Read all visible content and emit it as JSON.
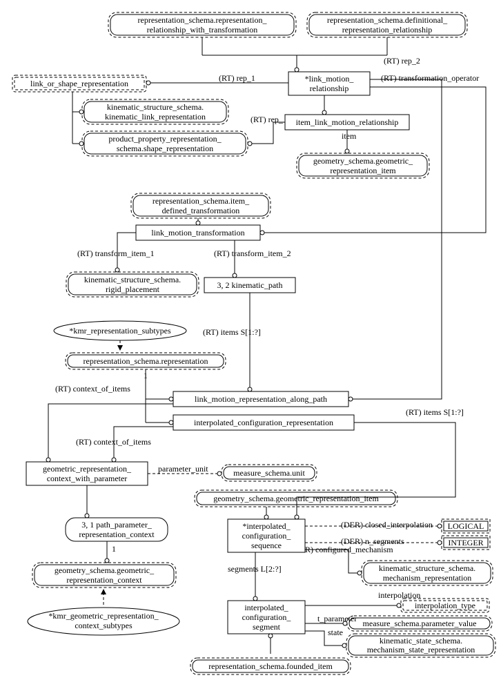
{
  "entities": {
    "rep_rel_with_trans": [
      "representation_schema.representation_",
      "relationship_with_transformation"
    ],
    "def_rep_rel": [
      "representation_schema.definitional_",
      "representation_relationship"
    ],
    "link_or_shape_rep": "link_or_shape_representation",
    "link_motion_rel": [
      "*link_motion_",
      "relationship"
    ],
    "kin_link_rep": [
      "kinematic_structure_schema.",
      "kinematic_link_representation"
    ],
    "item_link_motion_rel": "item_link_motion_relationship",
    "prod_prop_rep": [
      "product_property_representation_",
      "schema.shape_representation"
    ],
    "geom_rep_item_1": [
      "geometry_schema.geometric_",
      "representation_item"
    ],
    "rep_item_def_trans": [
      "representation_schema.item_",
      "defined_transformation"
    ],
    "link_motion_trans": "link_motion_transformation",
    "kin_rigid_placement": [
      "kinematic_structure_schema.",
      "rigid_placement"
    ],
    "kinematic_path": "3, 2 kinematic_path",
    "kmr_rep_subtypes": "*kmr_representation_subtypes",
    "rep_schema_rep": "representation_schema.representation",
    "link_motion_rep_along_path": "link_motion_representation_along_path",
    "interp_config_rep": "interpolated_configuration_representation",
    "geom_rep_ctx_param": [
      "geometric_representation_",
      "context_with_parameter"
    ],
    "measure_unit": "measure_schema.unit",
    "geom_rep_item_2": "geometry_schema.geometric_representation_item",
    "path_param_rep_ctx": [
      "3, 1 path_parameter_",
      "representation_context"
    ],
    "interp_config_seq": [
      "*interpolated_",
      "configuration_",
      "sequence"
    ],
    "logical": "LOGICAL",
    "integer": "INTEGER",
    "geom_rep_ctx": [
      "geometry_schema.geometric_",
      "representation_context"
    ],
    "kin_mech_rep": [
      "kinematic_structure_schema.",
      "mechanism_representation"
    ],
    "kmr_geom_rep_ctx_sub": [
      "*kmr_geometric_representation_",
      "context_subtypes"
    ],
    "interp_config_seg": [
      "interpolated_",
      "configuration_",
      "segment"
    ],
    "interp_type": "interpolation_type",
    "measure_param_val": "measure_schema.parameter_value",
    "kin_state_mech_rep": [
      "kinematic_state_schema.",
      "mechanism_state_representation"
    ],
    "rep_founded_item": "representation_schema.founded_item"
  },
  "edges": {
    "rep_1": "(RT) rep_1",
    "rep_2": "(RT) rep_2",
    "trans_op": "(RT) transformation_operator",
    "rep": "(RT) rep_",
    "item": "item",
    "trans_item_1": "(RT) transform_item_1",
    "trans_item_2": "(RT) transform_item_2",
    "items_s1": "(RT) items S[1:?]",
    "items_s1_b": "(RT) items S[1:?]",
    "context_of_items_a": "(RT) context_of_items",
    "context_of_items_b": "(RT) context_of_items",
    "one_a": "1",
    "one_b": "1",
    "param_unit": "parameter_unit",
    "der_closed": "(DER) closed_interpolation",
    "der_nseg": "(DER) n_segments",
    "conf_mech": "R) configured_mechanism",
    "segments": "segments L[2:?]",
    "interpolation": "interpolation",
    "t_param": "t_parameter",
    "state": "state"
  }
}
